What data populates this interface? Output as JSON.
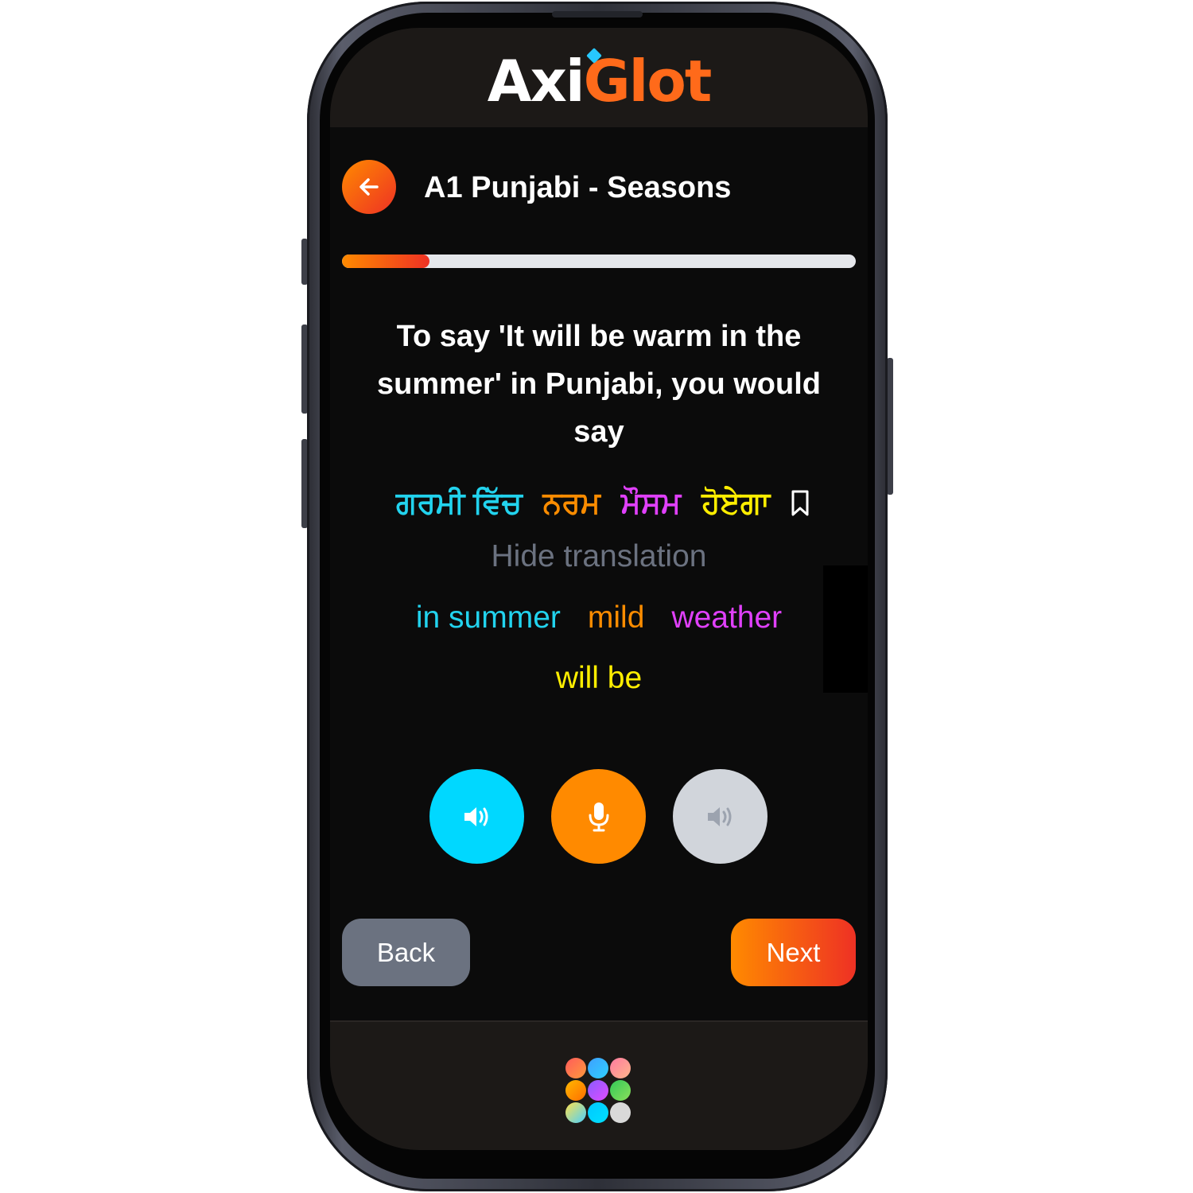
{
  "app": {
    "logo_part1": "Axi",
    "logo_part2": "Glot"
  },
  "lesson": {
    "title": "A1 Punjabi - Seasons",
    "progress": 0.17
  },
  "exercise": {
    "prompt": "To say 'It will be warm in the summer' in Punjabi, you would say",
    "target_words": [
      {
        "text": "ਗਰਮੀ ਵਿੱਚ",
        "color": "#22d3ee"
      },
      {
        "text": "ਨਰਮ",
        "color": "#fb8c00"
      },
      {
        "text": "ਮੌਸਮ",
        "color": "#e040fb"
      },
      {
        "text": "ਹੋਏਗਾ",
        "color": "#ffee00"
      }
    ],
    "toggle_translation_label": "Hide translation",
    "translation_words": [
      {
        "text": "in summer",
        "color": "#22d3ee"
      },
      {
        "text": "mild",
        "color": "#fb8c00"
      },
      {
        "text": "weather",
        "color": "#e040fb"
      },
      {
        "text": "will be",
        "color": "#ffee00"
      }
    ]
  },
  "audio_controls": {
    "play_icon": "speaker-icon",
    "record_icon": "microphone-icon",
    "playback_icon": "speaker-icon",
    "colors": [
      "#00d8ff",
      "#ff8a00",
      "#d1d5db"
    ]
  },
  "navigation": {
    "back_label": "Back",
    "next_label": "Next"
  },
  "footer": {
    "menu_icon": "app-grid-icon"
  }
}
